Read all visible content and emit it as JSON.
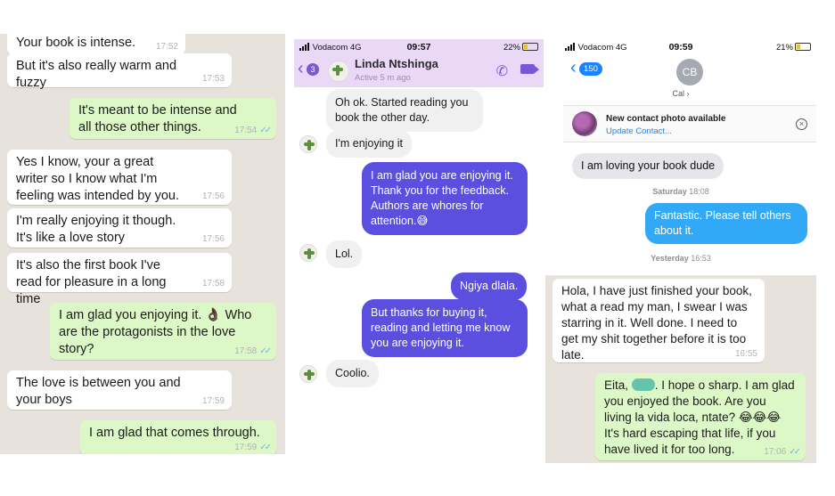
{
  "whatsapp": {
    "messages": [
      {
        "dir": "in",
        "text": "Your book is intense.",
        "time": "17:52"
      },
      {
        "dir": "in",
        "text": "But it's also really warm and fuzzy",
        "time": "17:53"
      },
      {
        "dir": "out",
        "text": "It's meant to be intense and all those other things.",
        "time": "17:54",
        "ticks": "✓✓"
      },
      {
        "dir": "in",
        "text": "Yes I know, your a great writer so I know what I'm feeling was intended by you.",
        "time": "17:56"
      },
      {
        "dir": "in",
        "text": "I'm really enjoying it though. It's like a love story",
        "time": "17:56"
      },
      {
        "dir": "in",
        "text": "It's also the first book I've read for pleasure in a long time",
        "time": "17:58"
      },
      {
        "dir": "out",
        "text": "I am glad you enjoying it. 👌🏿 Who are the protagonists in the love story?",
        "time": "17:58",
        "ticks": "✓✓"
      },
      {
        "dir": "in",
        "text": "The love is between you and your boys",
        "time": "17:59"
      },
      {
        "dir": "out",
        "text": "I am glad that comes through.",
        "time": "17:59",
        "ticks": "✓✓"
      }
    ]
  },
  "messenger": {
    "status": {
      "carrier": "Vodacom  4G",
      "time": "09:57",
      "battery": "22%"
    },
    "header": {
      "back_badge": "3",
      "name": "Linda Ntshinga",
      "active": "Active 5 m ago"
    },
    "messages": [
      {
        "dir": "in",
        "text": "Oh ok. Started reading you book the other day."
      },
      {
        "dir": "in",
        "text": "I'm enjoying it"
      },
      {
        "dir": "out",
        "text": "I am glad you are enjoying it. Thank you for the feedback. Authors are whores for attention.😅"
      },
      {
        "dir": "in",
        "text": "Lol."
      },
      {
        "dir": "out",
        "text": "Ngiya dlala."
      },
      {
        "dir": "out",
        "text": "But thanks for buying it, reading and letting me know you are enjoying it."
      },
      {
        "dir": "in",
        "text": "Coolio."
      }
    ]
  },
  "imessage": {
    "status": {
      "carrier": "Vodacom  4G",
      "time": "09:59",
      "battery": "21%"
    },
    "header": {
      "back_badge": "150",
      "initials": "CB",
      "contact": "Cal ›"
    },
    "notice": {
      "title": "New contact photo available",
      "link": "Update Contact..."
    },
    "messages": [
      {
        "dir": "in",
        "text": "I am loving your book dude"
      },
      {
        "dir": "stamp",
        "day": "Saturday",
        "time": "18:08"
      },
      {
        "dir": "out",
        "text": "Fantastic. Please tell others about it."
      },
      {
        "dir": "stamp",
        "day": "Yesterday",
        "time": "16:53"
      }
    ],
    "whatsapp_tail": [
      {
        "dir": "in",
        "text": "Hola, I have just finished your book, what a read my man, I swear I was starring in it. Well done. I need to get my shit together before it is too late.",
        "time": "16:55"
      },
      {
        "dir": "out",
        "text_a": "Eita,",
        "text_b": ". I hope o sharp. I am glad you enjoyed the book. Are you living la vida loca, ntate? 😂😂😂 It's hard escaping that life, if you have lived it for too long.",
        "time": "17:06",
        "ticks": "✓✓"
      }
    ]
  },
  "colors": {
    "wa_bg": "#e7e3dc",
    "wa_out": "#dcf8c6",
    "ms_out": "#5b4fe0",
    "ms_header": "#e9d9f7",
    "im_out": "#32a9f7",
    "im_in": "#e5e5ea"
  }
}
